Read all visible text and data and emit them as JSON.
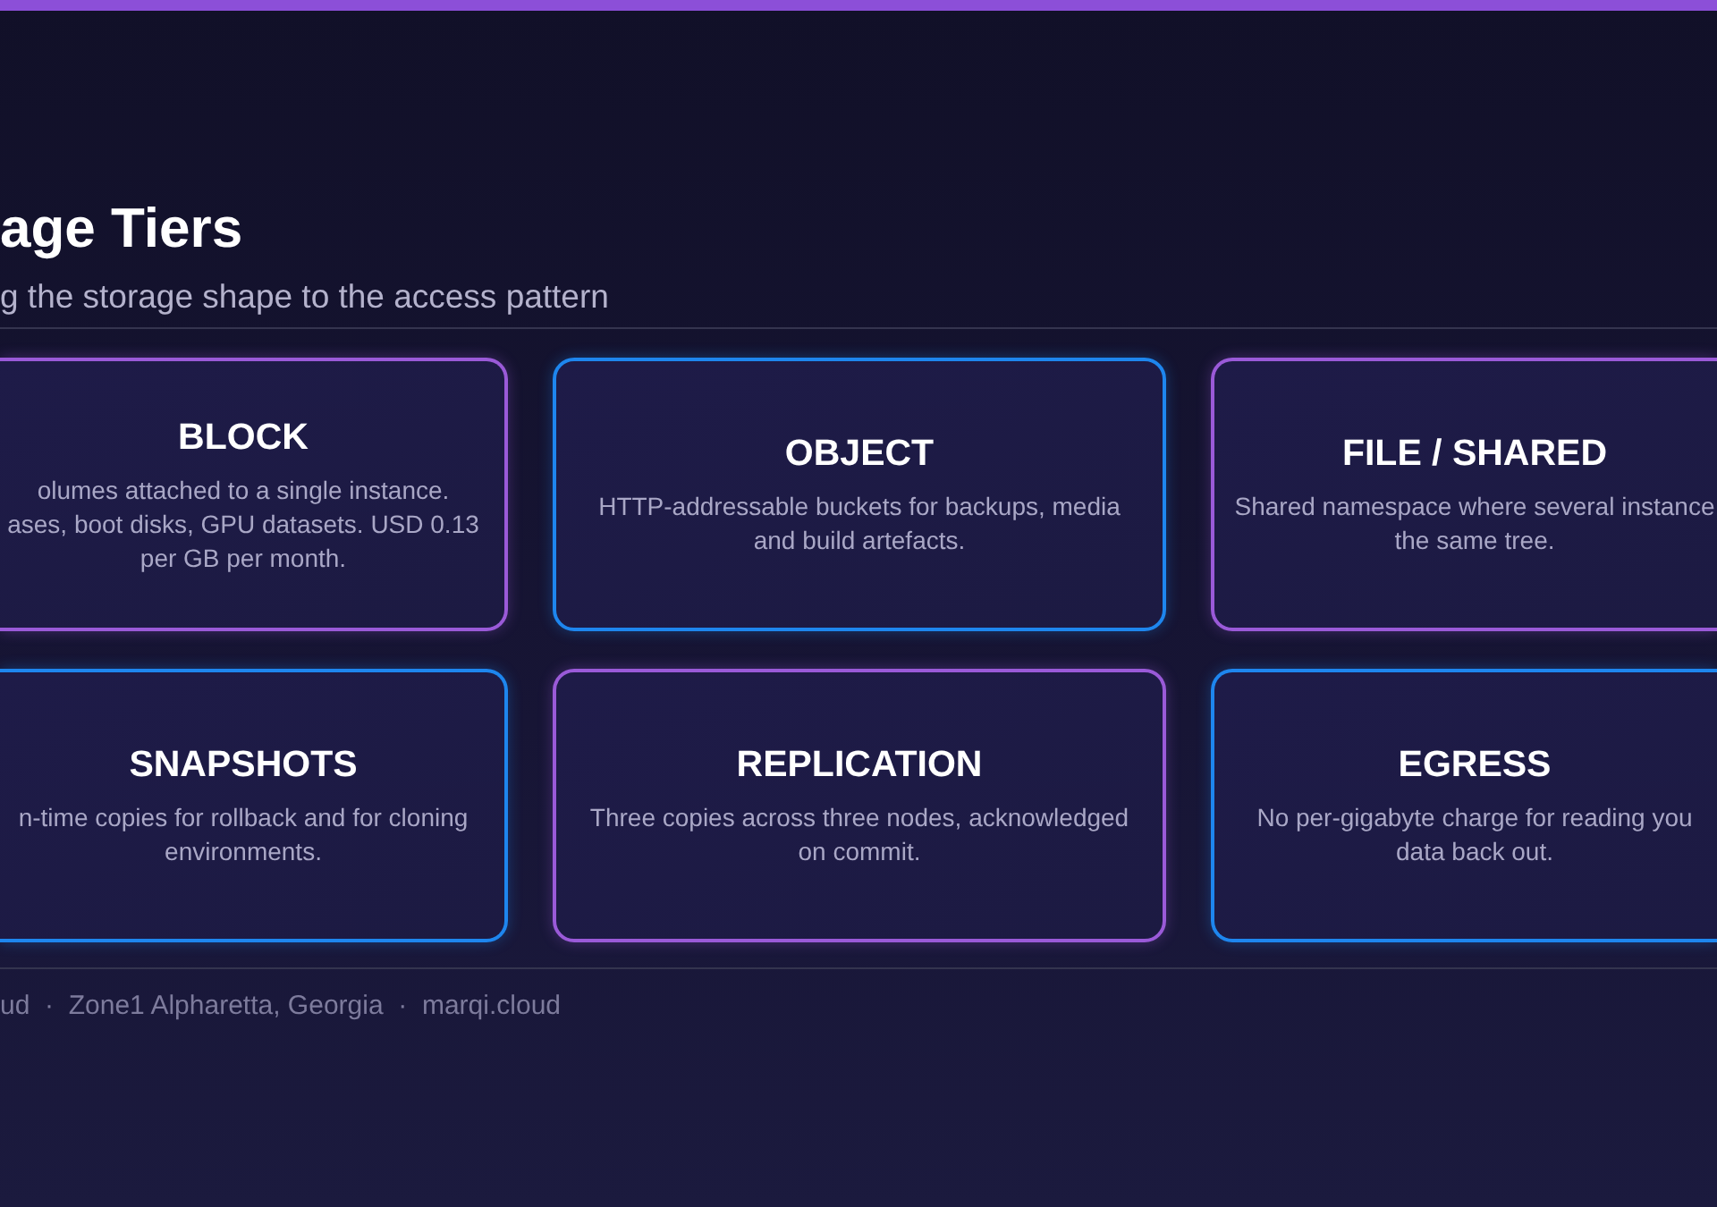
{
  "header": {
    "title": "age Tiers",
    "subtitle": "g the storage shape to the access pattern"
  },
  "cards": [
    {
      "title": "BLOCK",
      "color": "#9a5ad8",
      "lines": [
        "olumes attached to a single instance.",
        "ases, boot disks, GPU datasets. USD 0.13",
        "per GB per month."
      ]
    },
    {
      "title": "OBJECT",
      "color": "#1e86ee",
      "lines": [
        "HTTP-addressable buckets for backups, media",
        "and build artefacts."
      ]
    },
    {
      "title": "FILE / SHARED",
      "color": "#9a5ad8",
      "lines": [
        "Shared namespace where several instance",
        "the same tree."
      ]
    },
    {
      "title": "SNAPSHOTS",
      "color": "#1e86ee",
      "lines": [
        "n-time copies for rollback and for cloning",
        "environments."
      ]
    },
    {
      "title": "REPLICATION",
      "color": "#9a5ad8",
      "lines": [
        "Three copies across three nodes, acknowledged",
        "on commit."
      ]
    },
    {
      "title": "EGRESS",
      "color": "#1e86ee",
      "lines": [
        "No per-gigabyte charge for reading you",
        "data back out."
      ]
    }
  ],
  "footer": {
    "text": "ud  ·  Zone1 Alpharetta, Georgia  ·  marqi.cloud"
  }
}
